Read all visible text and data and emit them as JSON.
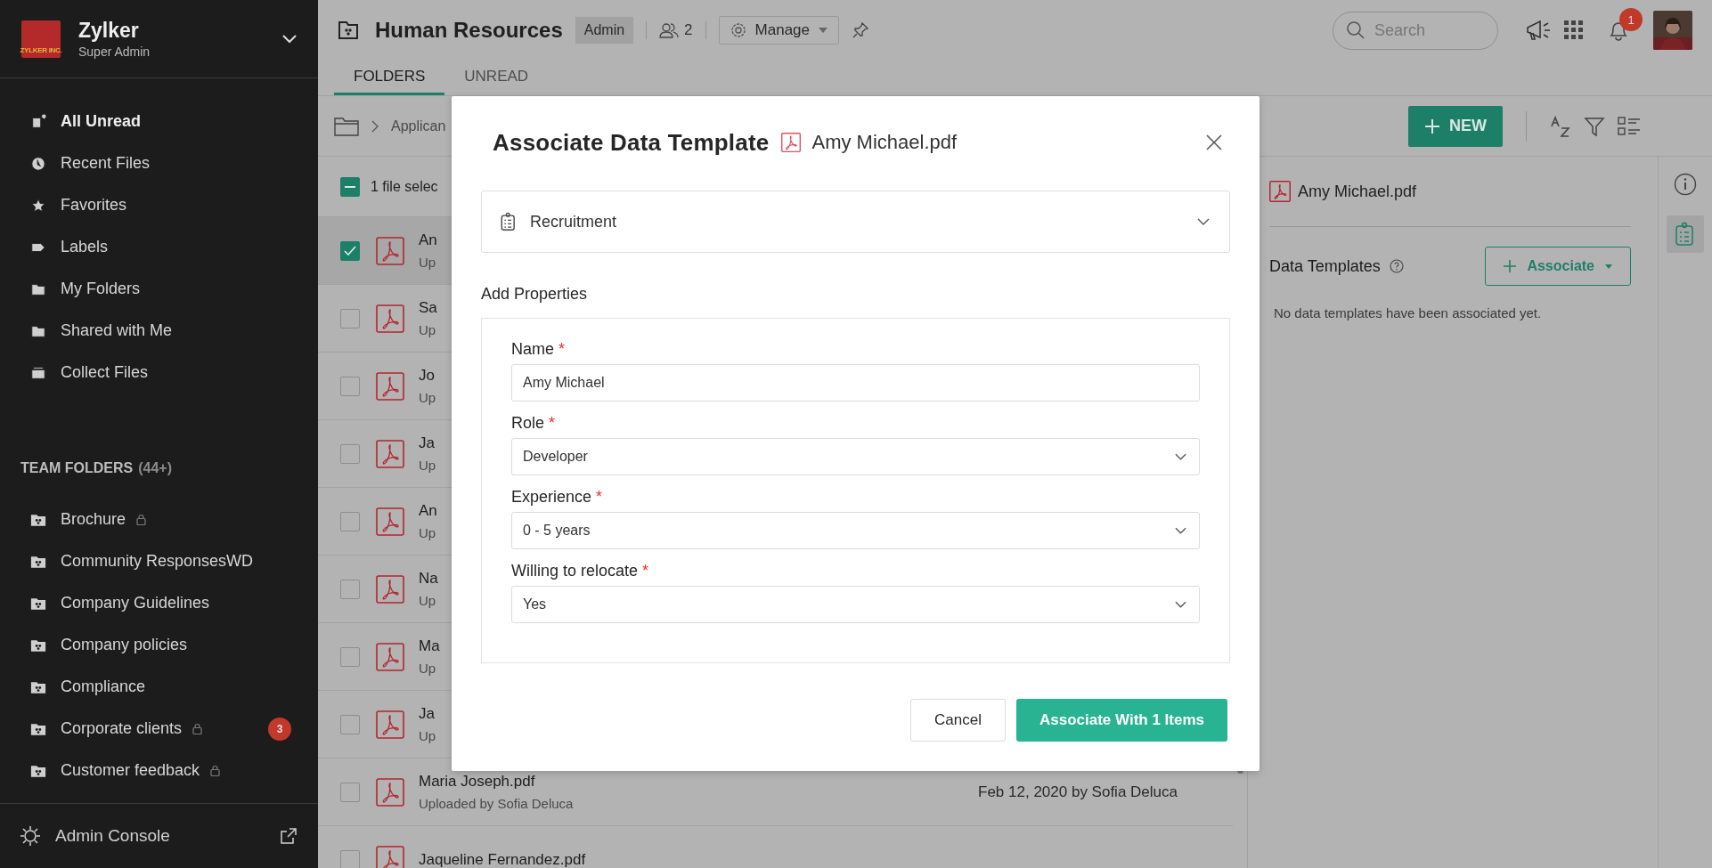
{
  "sidebar": {
    "org": {
      "name": "Zylker",
      "role": "Super Admin",
      "logo_text": "ZYLKER INC."
    },
    "nav": [
      {
        "label": "All Unread",
        "unread": true
      },
      {
        "label": "Recent Files",
        "unread": false
      },
      {
        "label": "Favorites",
        "unread": false
      },
      {
        "label": "Labels",
        "unread": false
      },
      {
        "label": "My Folders",
        "unread": false
      },
      {
        "label": "Shared with Me",
        "unread": false
      },
      {
        "label": "Collect Files",
        "unread": false
      }
    ],
    "team_folders": {
      "title": "TEAM FOLDERS",
      "count": "(44+)",
      "items": [
        {
          "label": "Brochure",
          "locked": true
        },
        {
          "label": "Community ResponsesWD",
          "locked": false
        },
        {
          "label": "Company Guidelines",
          "locked": false
        },
        {
          "label": "Company policies",
          "locked": false
        },
        {
          "label": "Compliance",
          "locked": false
        },
        {
          "label": "Corporate clients",
          "locked": true,
          "badge": "3"
        },
        {
          "label": "Customer feedback",
          "locked": true
        }
      ]
    },
    "footer": {
      "label": "Admin Console"
    }
  },
  "header": {
    "title": "Human Resources",
    "role_badge": "Admin",
    "members": "2",
    "manage": "Manage",
    "search": {
      "placeholder": "Search"
    },
    "notifications": "1"
  },
  "tabs": [
    {
      "label": "FOLDERS",
      "selected": true
    },
    {
      "label": "UNREAD",
      "selected": false
    }
  ],
  "toolbar": {
    "breadcrumb": "Applican",
    "new_button": "NEW"
  },
  "selection": {
    "label": "1 file selec",
    "partial": true
  },
  "files": [
    {
      "name": "An",
      "subtitle": "Up",
      "checked": true
    },
    {
      "name": "Sa",
      "subtitle": "Up",
      "checked": false
    },
    {
      "name": "Jo",
      "subtitle": "Up",
      "checked": false
    },
    {
      "name": "Ja",
      "subtitle": "Up",
      "checked": false
    },
    {
      "name": "An",
      "subtitle": "Up",
      "checked": false
    },
    {
      "name": "Na",
      "subtitle": "Up",
      "checked": false
    },
    {
      "name": "Ma",
      "subtitle": "Up",
      "checked": false
    },
    {
      "name": "Ja",
      "subtitle": "Up",
      "checked": false
    },
    {
      "name": "Maria Joseph.pdf",
      "subtitle": "Uploaded by Sofia Deluca",
      "modified": "Feb 12, 2020 by Sofia Deluca",
      "checked": false
    },
    {
      "name": "Jaqueline Fernandez.pdf",
      "checked": false
    }
  ],
  "details_panel": {
    "file": "Amy Michael.pdf",
    "section": "Data Templates",
    "associate": "Associate",
    "empty": "No data templates have been associated yet."
  },
  "modal": {
    "title": "Associate Data Template",
    "file": "Amy Michael.pdf",
    "template": "Recruitment",
    "section": "Add Properties",
    "fields": [
      {
        "label": "Name",
        "required_mark": "*",
        "kind": "text",
        "value": "Amy Michael"
      },
      {
        "label": "Role",
        "required_mark": "*",
        "kind": "select",
        "value": "Developer"
      },
      {
        "label": "Experience",
        "required_mark": "*",
        "kind": "select",
        "value": "0 - 5 years"
      },
      {
        "label": "Willing to relocate",
        "required_mark": "*",
        "kind": "select",
        "value": "Yes"
      }
    ],
    "buttons": [
      {
        "label": "Cancel",
        "kind": "secondary"
      },
      {
        "label": "Associate With 1 Items",
        "kind": "primary"
      }
    ]
  }
}
